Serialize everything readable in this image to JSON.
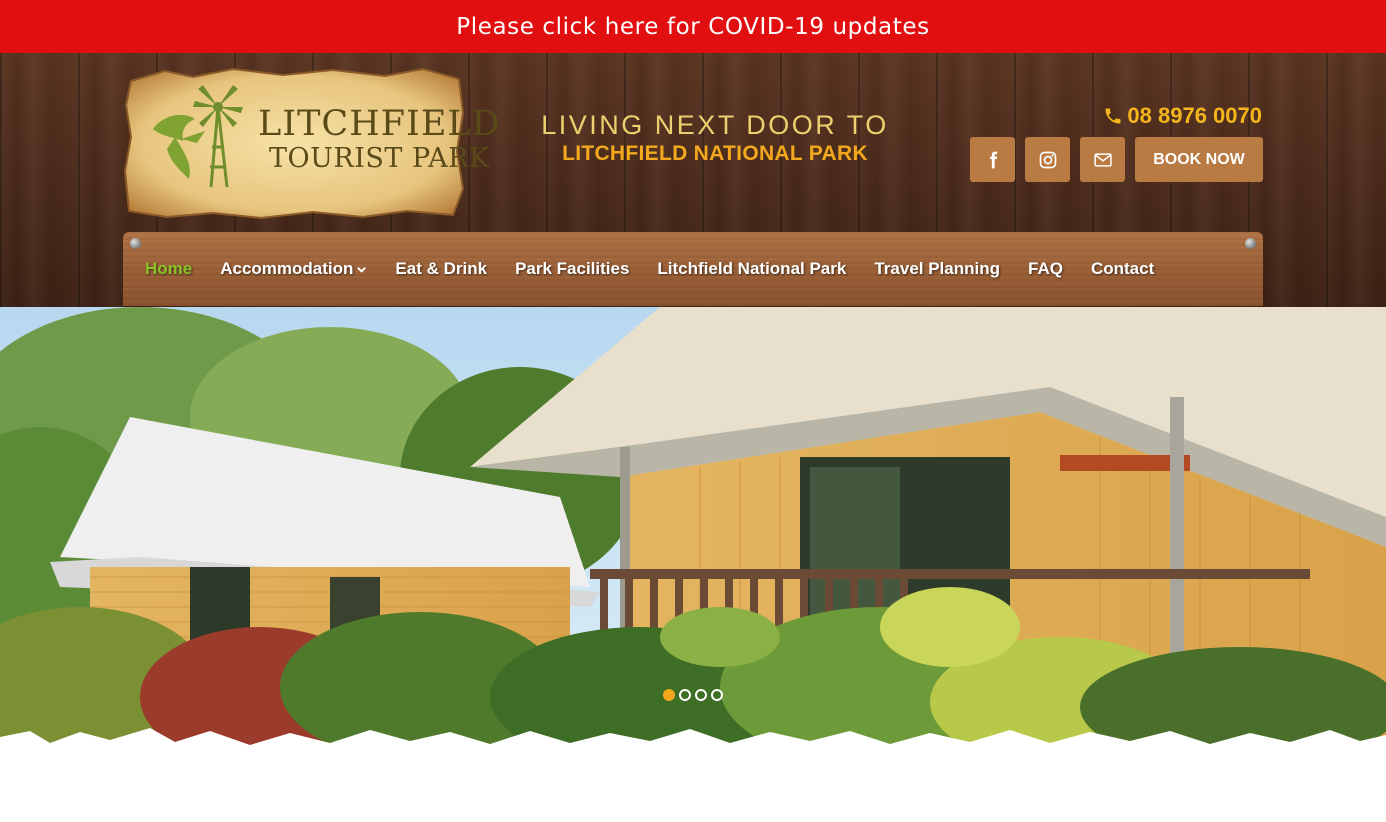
{
  "banner": {
    "text": "Please click here for COVID-19 updates"
  },
  "logo": {
    "line1": "LITCHFIELD",
    "line2": "TOURIST PARK"
  },
  "tagline": {
    "line1": "LIVING NEXT DOOR TO",
    "line2": "LITCHFIELD NATIONAL PARK"
  },
  "contact": {
    "phone": "08 8976 0070",
    "book_label": "BOOK NOW"
  },
  "icons": {
    "phone": "phone-icon",
    "facebook": "facebook-icon",
    "instagram": "instagram-icon",
    "email": "envelope-icon",
    "chevron": "chevron-down-icon"
  },
  "nav": {
    "items": [
      {
        "label": "Home",
        "active": true
      },
      {
        "label": "Accommodation",
        "has_dropdown": true
      },
      {
        "label": "Eat & Drink"
      },
      {
        "label": "Park Facilities"
      },
      {
        "label": "Litchfield National Park"
      },
      {
        "label": "Travel Planning"
      },
      {
        "label": "FAQ"
      },
      {
        "label": "Contact"
      }
    ]
  },
  "slider": {
    "slide_count": 4,
    "active_index": 0
  },
  "colors": {
    "banner_red": "#e20f10",
    "accent_orange": "#f3a81d",
    "nav_active_green": "#8bc227",
    "button_brown": "#b97a43"
  }
}
